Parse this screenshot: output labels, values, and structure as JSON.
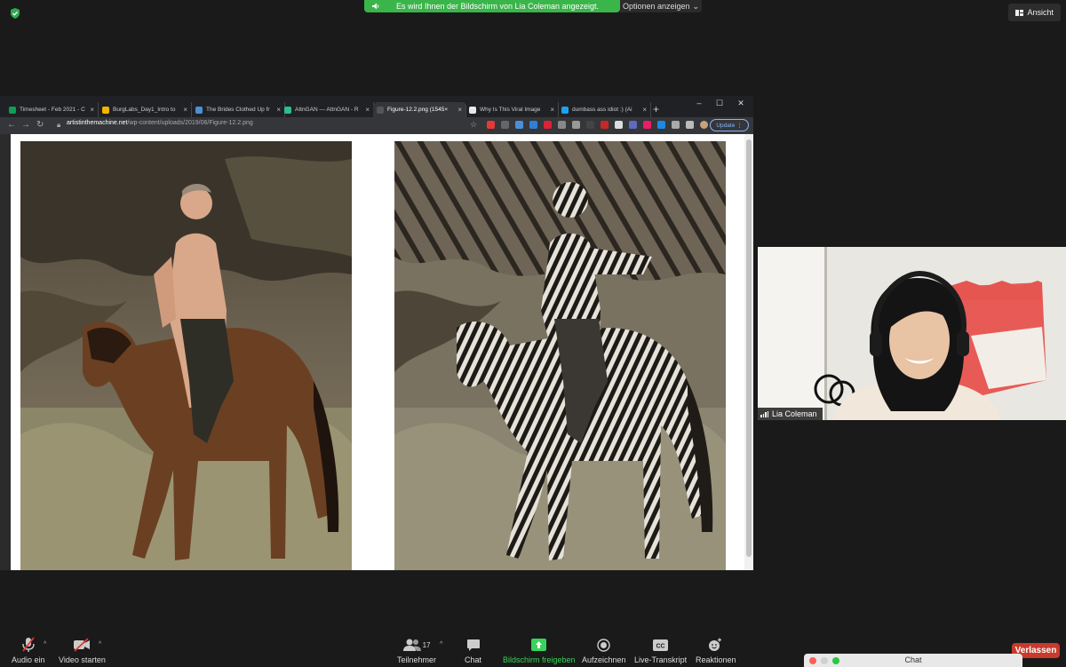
{
  "zoom": {
    "share_banner": "Es wird Ihnen der Bildschirm von Lia Coleman angezeigt.",
    "options_label": "Optionen anzeigen",
    "view_label": "Ansicht",
    "participant_name": "Lia Coleman",
    "participant_count": "17",
    "controls": {
      "audio": "Audio ein",
      "video": "Video starten",
      "participants": "Teilnehmer",
      "chat": "Chat",
      "share": "Bildschirm freigeben",
      "record": "Aufzeichnen",
      "transcript": "Live-Transkript",
      "reactions": "Reaktionen"
    },
    "leave_label": "Verlassen",
    "chat_window_title": "Chat",
    "colors": {
      "green": "#38d35a",
      "leave": "#c83b2c",
      "banner": "#3ab54a"
    }
  },
  "browser": {
    "tabs": [
      {
        "title": "Timesheet - Feb 2021 - C",
        "favicon_color": "#0f9d58"
      },
      {
        "title": "BurgLabs_Day1_Intro to",
        "favicon_color": "#f4b400"
      },
      {
        "title": "The Brides Clothed Up fr",
        "favicon_color": "#4a90d9"
      },
      {
        "title": "AttnGAN — AttnGAN - R",
        "favicon_color": "#2bbf8a"
      },
      {
        "title": "Figure-12.2.png (1545×",
        "favicon_color": "#555555"
      },
      {
        "title": "Why Is This Viral Image",
        "favicon_color": "#e8e8e8"
      },
      {
        "title": "dumbass ass idiot :) (Ai",
        "favicon_color": "#1da1f2"
      }
    ],
    "url_domain": "artistinthemachine.net",
    "url_path": "/wp-content/uploads/2019/06/Figure-12.2.png",
    "update_label": "Update"
  }
}
